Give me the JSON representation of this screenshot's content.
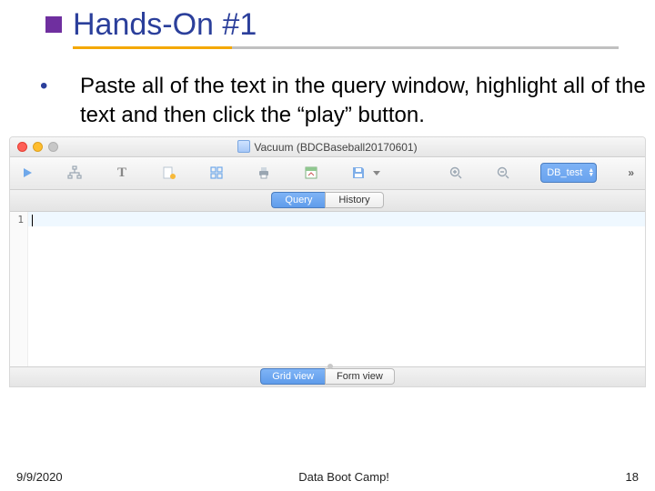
{
  "slide": {
    "title": "Hands-On #1",
    "bullet": "Paste all of the text in the query window, highlight all of the text and then click the “play” button."
  },
  "app": {
    "window_title": "Vacuum (BDCBaseball20170601)",
    "tabs": {
      "query": "Query",
      "history": "History"
    },
    "db_selector": "DB_test",
    "line_number": "1",
    "bottom_tabs": {
      "grid": "Grid view",
      "form": "Form view"
    }
  },
  "footer": {
    "date": "9/9/2020",
    "center": "Data Boot Camp!",
    "page": "18"
  }
}
